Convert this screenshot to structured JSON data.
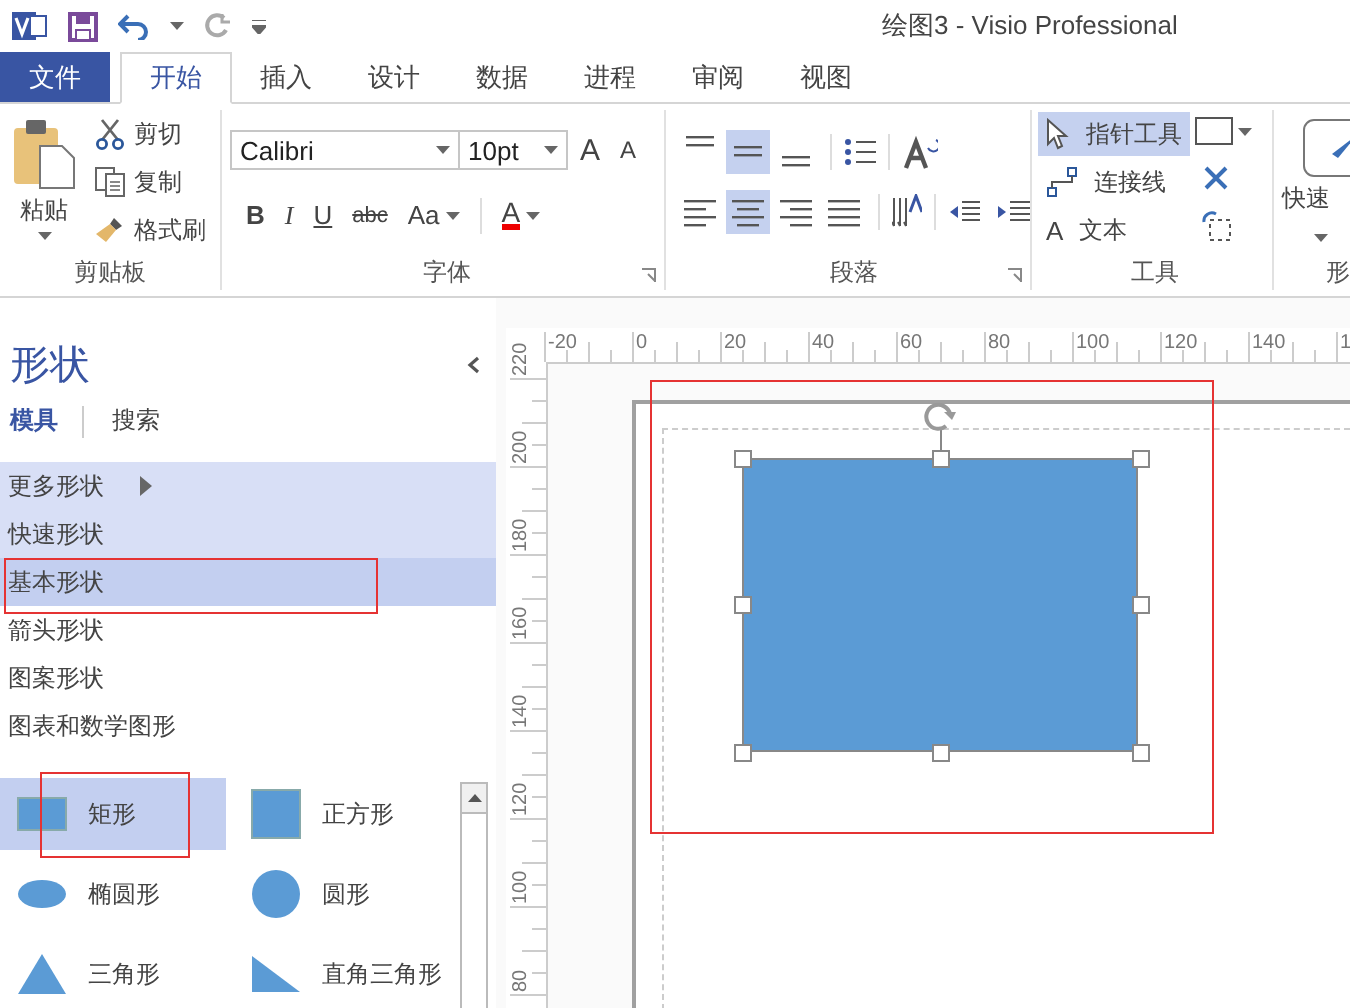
{
  "window": {
    "title": "绘图3 - Visio Professional"
  },
  "tabs": [
    {
      "label": "文件",
      "kind": "file",
      "selected": false
    },
    {
      "label": "开始",
      "kind": "tab",
      "selected": true
    },
    {
      "label": "插入",
      "kind": "tab",
      "selected": false
    },
    {
      "label": "设计",
      "kind": "tab",
      "selected": false
    },
    {
      "label": "数据",
      "kind": "tab",
      "selected": false
    },
    {
      "label": "进程",
      "kind": "tab",
      "selected": false
    },
    {
      "label": "审阅",
      "kind": "tab",
      "selected": false
    },
    {
      "label": "视图",
      "kind": "tab",
      "selected": false
    }
  ],
  "clipboard": {
    "label": "剪贴板",
    "paste": "粘贴",
    "items": [
      {
        "label": "剪切",
        "kind": "cut"
      },
      {
        "label": "复制",
        "kind": "copy"
      },
      {
        "label": "格式刷",
        "kind": "brush"
      }
    ]
  },
  "font": {
    "label": "字体",
    "family": "Calibri",
    "size": "10pt",
    "size_buttons": [
      {
        "text": "A",
        "kind": "grow"
      },
      {
        "text": "A",
        "kind": "shrink"
      }
    ],
    "format_buttons": [
      {
        "text": "B",
        "kind": "bold"
      },
      {
        "text": "I",
        "kind": "italic"
      },
      {
        "text": "U",
        "kind": "underline"
      },
      {
        "text": "abc",
        "kind": "strike"
      },
      {
        "text": "Aa",
        "kind": "case"
      },
      {
        "text": "A",
        "kind": "color"
      }
    ]
  },
  "paragraph": {
    "label": "段落",
    "vertical_align": [
      {
        "selected": false
      },
      {
        "selected": true
      },
      {
        "selected": false
      }
    ],
    "horizontal_align": [
      {
        "selected": false
      },
      {
        "selected": true
      },
      {
        "selected": false
      },
      {
        "selected": false
      }
    ]
  },
  "tools": {
    "label": "工具",
    "items": [
      {
        "label": "指针工具",
        "kind": "pointer",
        "selected": true
      },
      {
        "label": "连接线",
        "kind": "connector",
        "selected": false
      },
      {
        "label": "文本",
        "kind": "text",
        "icon_text": "A",
        "selected": false
      }
    ]
  },
  "shape_styles": {
    "label": "形",
    "button": "快速"
  },
  "shapes_panel": {
    "title": "形状",
    "tabs": [
      {
        "label": "模具",
        "selected": true
      },
      {
        "label": "搜索",
        "selected": false
      }
    ],
    "stencils": [
      {
        "label": "更多形状",
        "kind": "menu",
        "open": true,
        "selected": false
      },
      {
        "label": "快速形状",
        "kind": "stencil",
        "open": true,
        "selected": false
      },
      {
        "label": "基本形状",
        "kind": "stencil",
        "open": true,
        "selected": true
      },
      {
        "label": "箭头形状",
        "kind": "stencil",
        "open": false,
        "selected": false
      },
      {
        "label": "图案形状",
        "kind": "stencil",
        "open": false,
        "selected": false
      },
      {
        "label": "图表和数学图形",
        "kind": "stencil",
        "open": false,
        "selected": false
      }
    ],
    "masters": [
      {
        "label": "矩形",
        "kind": "rectangle",
        "selected": true
      },
      {
        "label": "正方形",
        "kind": "square",
        "selected": false
      },
      {
        "label": "椭圆形",
        "kind": "ellipse",
        "selected": false
      },
      {
        "label": "圆形",
        "kind": "circle",
        "selected": false
      },
      {
        "label": "三角形",
        "kind": "triangle",
        "selected": false
      },
      {
        "label": "直角三角形",
        "kind": "right-triangle",
        "selected": false
      }
    ]
  },
  "ruler_horizontal": [
    "-20",
    "0",
    "20",
    "40",
    "60",
    "80",
    "100",
    "120",
    "140",
    "1"
  ],
  "ruler_vertical": [
    "220",
    "200",
    "180",
    "160",
    "140",
    "120",
    "100",
    "80"
  ],
  "drawing": {
    "shape": {
      "kind": "rectangle",
      "selected": true
    }
  }
}
